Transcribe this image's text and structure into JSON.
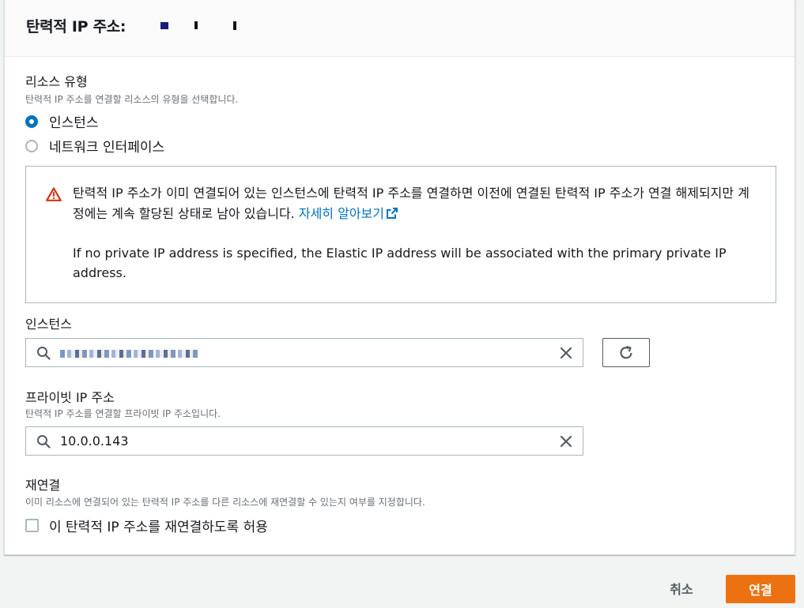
{
  "header": {
    "title": "탄력적 IP 주소:"
  },
  "resource_type": {
    "label": "리소스 유형",
    "description": "탄력적 IP 주소를 연결할 리소스의 유형을 선택합니다.",
    "options": [
      {
        "label": "인스턴스",
        "selected": true
      },
      {
        "label": "네트워크 인터페이스",
        "selected": false
      }
    ]
  },
  "alert": {
    "type": "warning",
    "message": "탄력적 IP 주소가 이미 연결되어 있는 인스턴스에 탄력적 IP 주소를 연결하면 이전에 연결된 탄력적 IP 주소가 연결 해제되지만 계정에는 계속 할당된 상태로 남아 있습니다.",
    "link_label": "자세히 알아보기",
    "note": "If no private IP address is specified, the Elastic IP address will be associated with the primary private IP address."
  },
  "instance": {
    "label": "인스턴스",
    "value": ""
  },
  "private_ip": {
    "label": "프라이빗 IP 주소",
    "description": "탄력적 IP 주소를 연결할 프라이빗 IP 주소입니다.",
    "value": "10.0.0.143"
  },
  "reassociation": {
    "label": "재연결",
    "description": "이미 리소스에 연결되어 있는 탄력적 IP 주소를 다른 리소스에 재연결할 수 있는지 여부를 지정합니다.",
    "checkbox_label": "이 탄력적 IP 주소를 재연결하도록 허용",
    "checked": false
  },
  "footer": {
    "cancel_label": "취소",
    "submit_label": "연결"
  },
  "colors": {
    "accent": "#0073bb",
    "primary_button": "#ec7211",
    "warning": "#d13212"
  }
}
